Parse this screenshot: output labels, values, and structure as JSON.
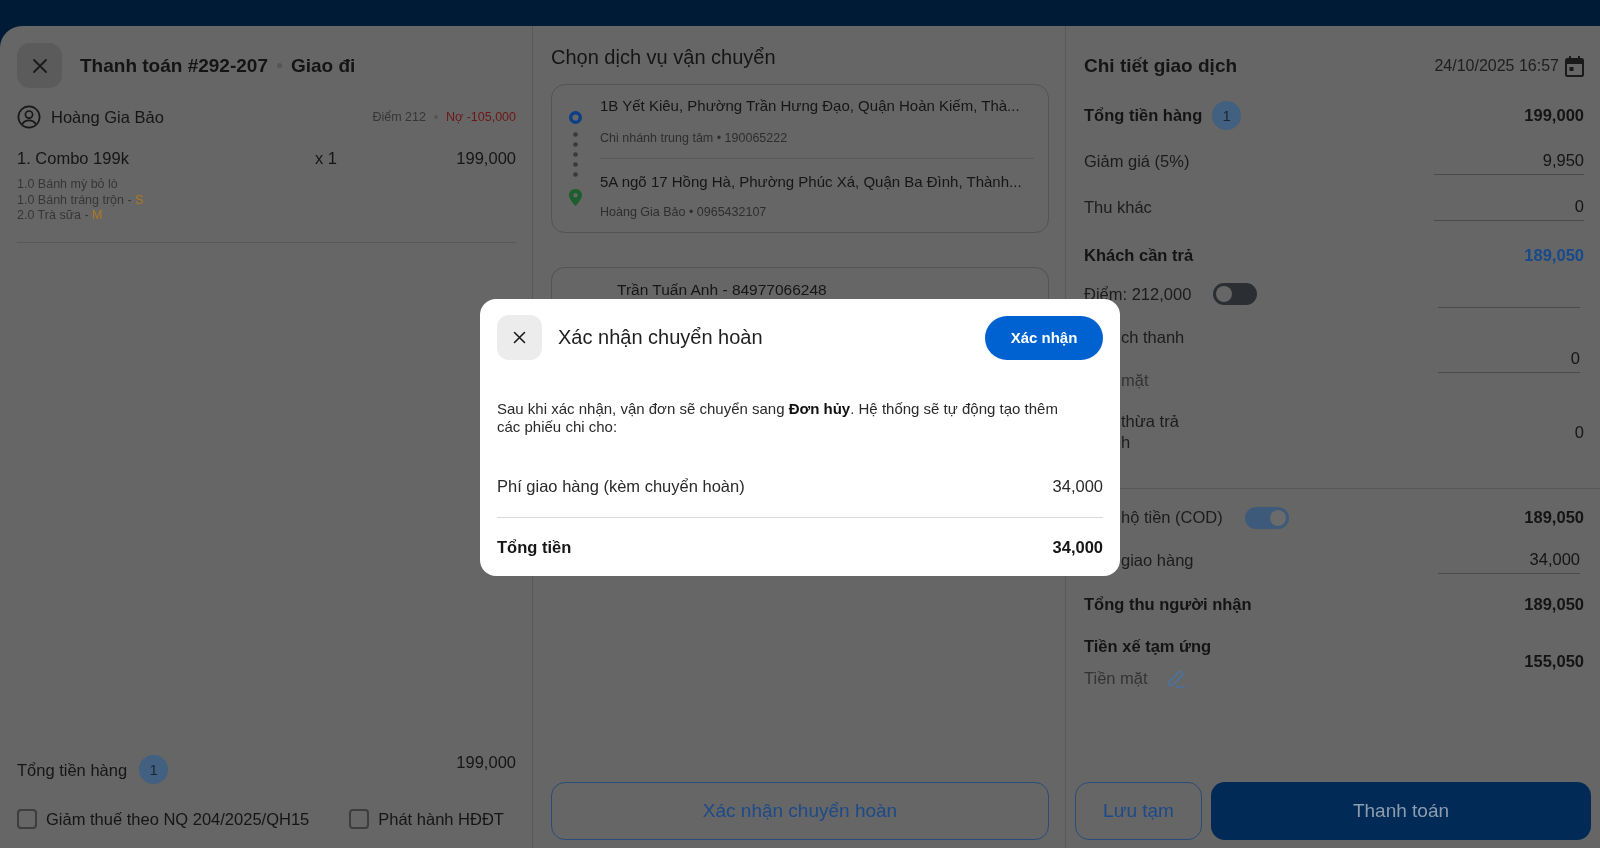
{
  "order_panel": {
    "title": "Thanh toán #292-207",
    "subtitle": "Giao đi",
    "customer": {
      "name": "Hoàng Gia Bảo",
      "points": "Điểm 212",
      "debt": "Nợ -105,000"
    },
    "items": [
      {
        "name": "1. Combo 199k",
        "quantity": "x 1",
        "price": "199,000",
        "options": [
          {
            "text": "1.0 Bánh mỳ bỏ lò"
          },
          {
            "text": "1.0 Bánh tráng trộn -",
            "size": "S"
          },
          {
            "text": "2.0 Trà sữa -",
            "size": "M"
          }
        ]
      }
    ],
    "total": {
      "label": "Tổng tiền hàng",
      "count": "1",
      "value": "199,000"
    },
    "checkboxes": [
      {
        "label": "Giảm thuế theo NQ 204/2025/QH15",
        "checked": false
      },
      {
        "label": "Phát hành HĐĐT",
        "checked": false
      }
    ]
  },
  "shipping_panel": {
    "title": "Chọn dịch vụ vận chuyển",
    "route": {
      "from": {
        "address": "1B Yết Kiêu, Phường Trần Hưng Đạo, Quận Hoàn Kiếm, Thà...",
        "contact": "Chi nhánh trung tâm • 190065222"
      },
      "to": {
        "address": "5A ngõ 17 Hồng Hà, Phường Phúc Xá, Quận Ba Đình, Thành...",
        "contact": "Hoàng Gia Bảo • 0965432107"
      }
    },
    "driver": "Trần Tuấn Anh - 84977066248",
    "action_button": "Xác nhận chuyển hoàn"
  },
  "transaction_panel": {
    "title": "Chi tiết giao dịch",
    "datetime": "24/10/2025 16:57",
    "sections": [
      {
        "rows": [
          {
            "kind": "total",
            "label": "Tổng tiền hàng",
            "count": "1",
            "value": "199,000"
          },
          {
            "kind": "input",
            "label": "Giảm giá (5%)",
            "value": "9,950"
          },
          {
            "kind": "input",
            "label": "Thu khác",
            "value": "0"
          },
          {
            "kind": "due",
            "label": "Khách cần trả",
            "value": "189,050"
          },
          {
            "kind": "points",
            "label": "Điểm: 212,000",
            "on": false
          },
          {
            "kind": "paid",
            "label": "ch thanh",
            "sublabel": "mặt",
            "value": "0"
          },
          {
            "kind": "change",
            "label_lines": [
              "thừa trả",
              "h"
            ],
            "value": "0"
          }
        ]
      },
      {
        "rows": [
          {
            "kind": "cod",
            "label": "hộ tiền (COD)",
            "on": true,
            "value": "189,050"
          },
          {
            "kind": "fee",
            "label": "giao hàng",
            "value": "34,000"
          },
          {
            "kind": "receiver_total",
            "label": "Tổng thu người nhận",
            "value": "189,050"
          },
          {
            "kind": "advance",
            "label": "Tiền xế tạm ứng",
            "sublabel": "Tiền mặt",
            "value": "155,050"
          }
        ]
      }
    ],
    "buttons": [
      {
        "kind": "outline",
        "label": "Lưu tạm"
      },
      {
        "kind": "primary",
        "label": "Thanh toán"
      }
    ]
  },
  "dialog": {
    "title": "Xác nhận chuyển hoàn",
    "confirm_button": "Xác nhận",
    "message": "Sau khi xác nhận, vận đơn sẽ chuyển sang **Đơn hủy**. Hệ thống sẽ tự động tạo thêm các phiếu chi cho:",
    "lines": [
      {
        "label": "Phí giao hàng (kèm chuyển hoàn)",
        "value": "34,000"
      }
    ],
    "total": {
      "label": "Tổng tiền",
      "value": "34,000"
    }
  }
}
